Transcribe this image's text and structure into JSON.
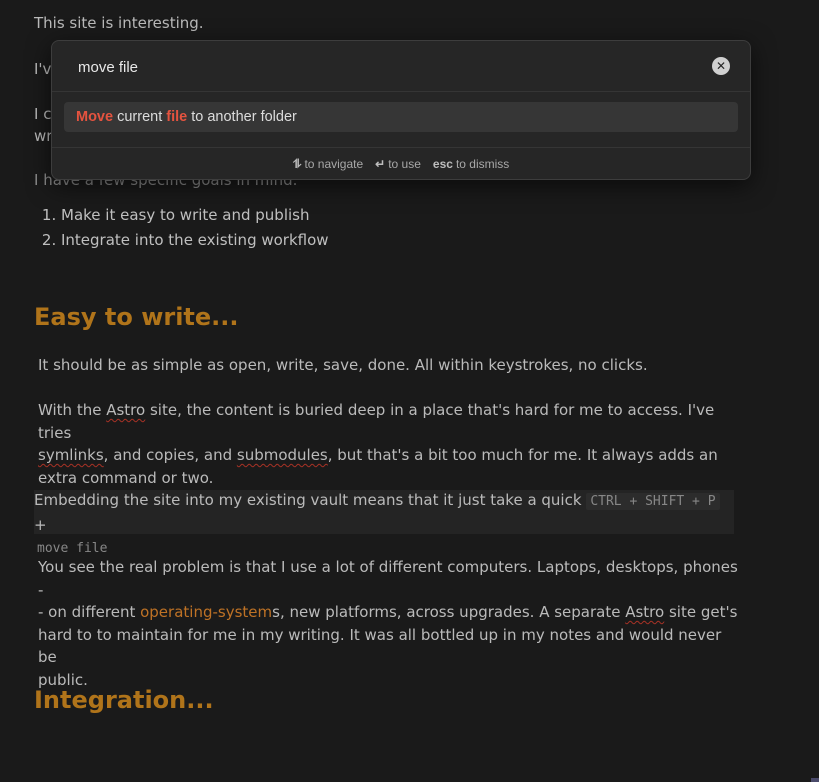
{
  "note": {
    "line1": "This site is interesting.",
    "line2_visible": "I'v",
    "line3_visible": "I c",
    "line3b_visible": "wr",
    "goals": "I have a few specific goals in mind.",
    "list": [
      "Make it easy to write and publish",
      "Integrate into the existing workflow"
    ],
    "heading1": "Easy to write...",
    "para1": "It should be as simple as open, write, save, done. All within keystrokes, no clicks.",
    "para2": {
      "a": "With the ",
      "astro": "Astro",
      "b": " site, the content is buried deep in a place that's hard for me to access. I've tries",
      "symlinks": "symlinks",
      "c": ", and copies, and ",
      "submodules": "submodules",
      "d": ", but that's a bit too much for me. It always adds an",
      "e": "extra command or two."
    },
    "embed": {
      "text": "Embedding the site into my existing vault means that it just take a quick ",
      "kbd": "CTRL + SHIFT + P",
      "plus": " +",
      "cmd": "move file"
    },
    "para3": {
      "a": "You see the real problem is that I use a lot of different computers. Laptops, desktops, phones -",
      "b": "- on different ",
      "link": "operating-system",
      "c": "s, new platforms, across upgrades. A separate ",
      "astro": "Astro",
      "d": " site get's",
      "e": "hard to to maintain for me in my writing. It was all bottled up in my notes and would never be",
      "f": "public."
    },
    "heading2": "Integration..."
  },
  "palette": {
    "query": "move file",
    "suggestion": {
      "m1": "Move",
      "t1": " current ",
      "m2": "file",
      "t2": " to another folder"
    },
    "hints": {
      "nav_key": "⥮",
      "nav": "to navigate",
      "use_key": "↵",
      "use": "to use",
      "esc_key": "esc",
      "dismiss": "to dismiss"
    }
  },
  "colors": {
    "heading": "#c9841e",
    "match": "#e5533f",
    "link": "#d9822b"
  }
}
